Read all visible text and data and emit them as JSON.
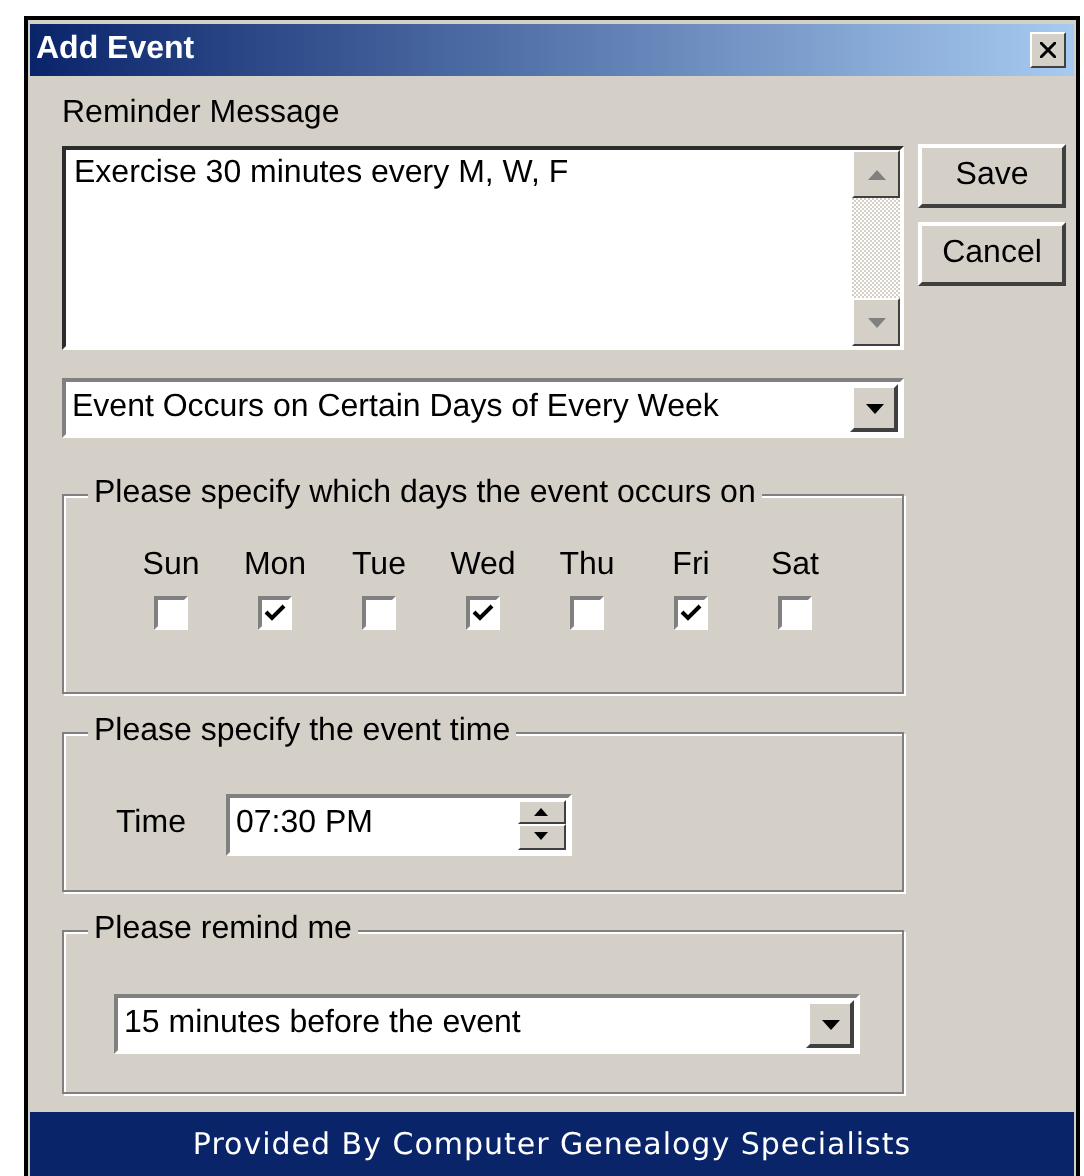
{
  "window": {
    "title": "Add Event"
  },
  "reminder": {
    "label": "Reminder Message",
    "value": "Exercise 30 minutes every M, W, F"
  },
  "buttons": [
    "Save",
    "Cancel"
  ],
  "recurrence": {
    "value": "Event Occurs on Certain Days of Every Week"
  },
  "days_group": {
    "title": "Please specify which days the event occurs on",
    "days": [
      {
        "label": "Sun",
        "checked": false
      },
      {
        "label": "Mon",
        "checked": true
      },
      {
        "label": "Tue",
        "checked": false
      },
      {
        "label": "Wed",
        "checked": true
      },
      {
        "label": "Thu",
        "checked": false
      },
      {
        "label": "Fri",
        "checked": true
      },
      {
        "label": "Sat",
        "checked": false
      }
    ]
  },
  "time_group": {
    "title": "Please specify the event time",
    "label": "Time",
    "value": "07:30 PM"
  },
  "remind_group": {
    "title": "Please remind me",
    "value": "15 minutes before the event"
  },
  "footer": "Provided By Computer Genealogy Specialists"
}
